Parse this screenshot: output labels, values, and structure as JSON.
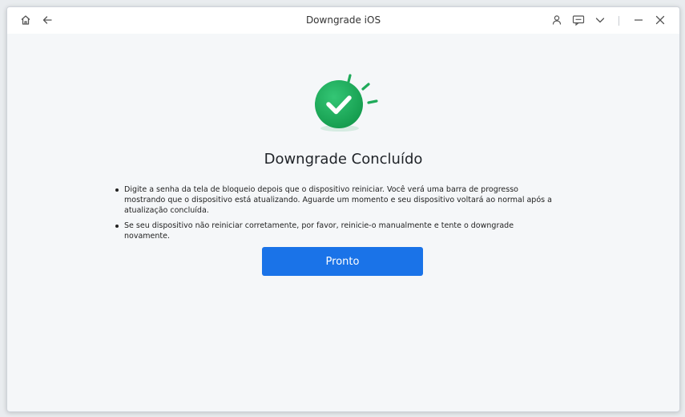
{
  "window": {
    "title": "Downgrade iOS"
  },
  "titlebar_icons": {
    "home": "home-icon",
    "back": "arrow-left-icon",
    "user": "user-icon",
    "feedback": "chat-icon",
    "menu": "chevron-down-icon",
    "minimize": "minimize-icon",
    "close": "close-icon"
  },
  "main": {
    "status_icon": "success-check-icon",
    "heading": "Downgrade Concluído",
    "bullets": [
      "Digite a senha da tela de bloqueio depois que o dispositivo reiniciar. Você verá uma barra de progresso mostrando que o dispositivo está atualizando. Aguarde um momento e seu dispositivo voltará ao normal após a atualização concluída.",
      "Se seu dispositivo não reiniciar corretamente, por favor, reinicie-o manualmente e tente o downgrade novamente."
    ],
    "done_button": "Pronto"
  },
  "colors": {
    "accent": "#1a73e8",
    "success": "#1faa5a"
  }
}
